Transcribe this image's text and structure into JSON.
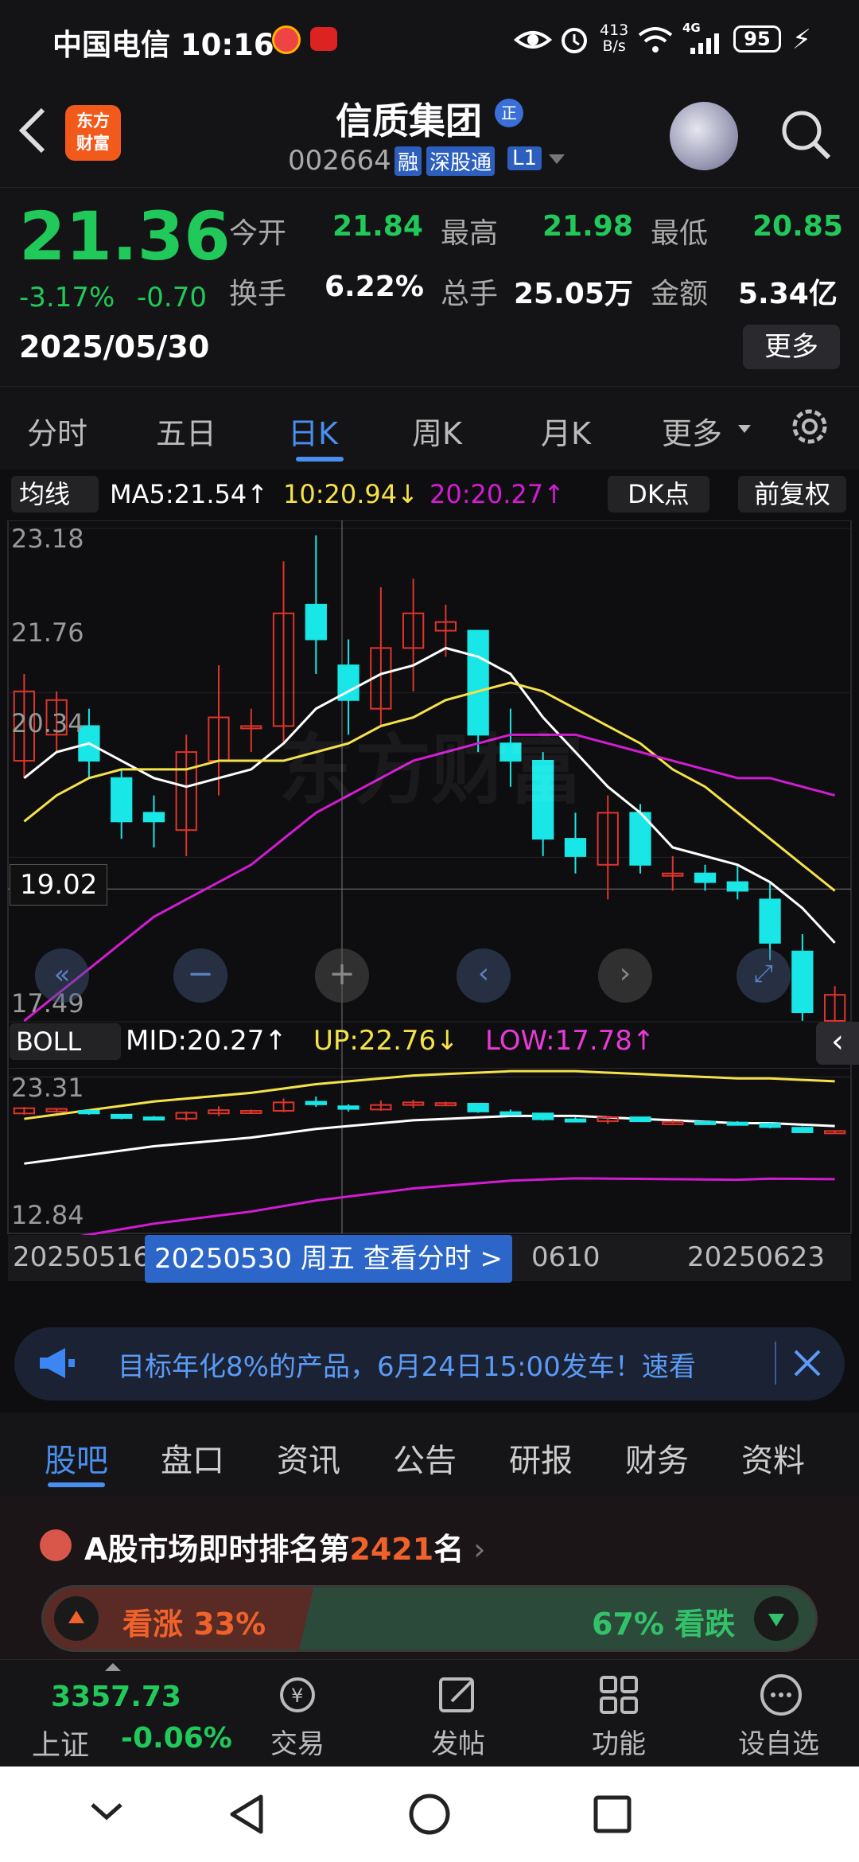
{
  "status_bar": {
    "carrier_time": "中国电信 10:16",
    "net_speed_value": "413",
    "net_speed_unit": "B/s",
    "signal_label": "4G",
    "battery": "95"
  },
  "header": {
    "app_logo_line1": "东方",
    "app_logo_line2": "财富",
    "stock_name": "信质集团",
    "stock_badge": "正",
    "stock_code": "002664",
    "tag_rong": "融",
    "tag_shengu": "深股通",
    "tag_level": "L1"
  },
  "quote": {
    "price": "21.36",
    "change_pct": "-3.17%",
    "change_abs": "-0.70",
    "date": "2025/05/30",
    "fields": [
      {
        "label": "今开",
        "value": "21.84"
      },
      {
        "label": "最高",
        "value": "21.98"
      },
      {
        "label": "最低",
        "value": "20.85"
      },
      {
        "label": "换手",
        "value": "6.22%"
      },
      {
        "label": "总手",
        "value": "25.05万"
      },
      {
        "label": "金额",
        "value": "5.34亿"
      }
    ],
    "more_label": "更多"
  },
  "period_tabs": [
    "分时",
    "五日",
    "日K",
    "周K",
    "月K",
    "更多"
  ],
  "indicator_row": {
    "ma_button": "均线",
    "ma5": "MA5:21.54↑",
    "ma10": "10:20.94↓",
    "ma20": "20:20.27↑",
    "dk_button": "DK点",
    "fq_button": "前复权"
  },
  "kline_axis": {
    "y_labels": [
      "23.18",
      "21.76",
      "20.34",
      "17.49"
    ],
    "crosshair_price": "19.02"
  },
  "boll_row": {
    "boll_button": "BOLL",
    "mid": "MID:20.27↑",
    "up": "UP:22.76↓",
    "low": "LOW:17.78↑"
  },
  "boll_axis": {
    "y_labels": [
      "23.31",
      "12.84"
    ]
  },
  "x_axis": {
    "left_date": "20250516",
    "mid_date_partial": "0610",
    "right_date": "20250623",
    "cursor_tip": "20250530 周五 查看分时 >"
  },
  "watermark": "东方财富",
  "notice": {
    "text": "目标年化8%的产品，6月24日15:00发车！速看"
  },
  "feature_tabs": [
    "股吧",
    "盘口",
    "资讯",
    "公告",
    "研报",
    "财务",
    "资料"
  ],
  "rank": {
    "prefix": "A股市场即时排名第",
    "number": "2421",
    "suffix": "名"
  },
  "sentiment": {
    "up_label": "看涨 33%",
    "down_label": "67% 看跌",
    "up_fraction": 0.33
  },
  "bottom_nav": {
    "index_value": "3357.73",
    "index_name": "上证",
    "index_change": "-0.06%",
    "items": [
      "交易",
      "发帖",
      "功能",
      "设自选"
    ]
  },
  "colors": {
    "up": "#e0342b",
    "down": "#19e6e6",
    "ma5": "#ffffff",
    "ma10": "#f5e24a",
    "ma20": "#d21cd2",
    "green": "#21c85a",
    "accent": "#4a8ff0"
  },
  "chart_data": {
    "type": "candlestick",
    "note_free": true,
    "ylim": [
      17.49,
      23.18
    ],
    "candles": [
      {
        "o": 20.5,
        "c": 21.3,
        "h": 21.5,
        "l": 20.3
      },
      {
        "o": 20.8,
        "c": 21.2,
        "h": 21.3,
        "l": 20.6
      },
      {
        "o": 20.9,
        "c": 20.5,
        "h": 21.1,
        "l": 20.3
      },
      {
        "o": 20.3,
        "c": 19.8,
        "h": 20.4,
        "l": 19.6
      },
      {
        "o": 19.9,
        "c": 19.8,
        "h": 20.1,
        "l": 19.5
      },
      {
        "o": 19.7,
        "c": 20.6,
        "h": 20.8,
        "l": 19.4
      },
      {
        "o": 20.5,
        "c": 21.0,
        "h": 21.6,
        "l": 20.1
      },
      {
        "o": 20.9,
        "c": 20.9,
        "h": 21.1,
        "l": 20.6
      },
      {
        "o": 20.9,
        "c": 22.2,
        "h": 22.8,
        "l": 20.7
      },
      {
        "o": 22.3,
        "c": 21.9,
        "h": 23.1,
        "l": 21.5
      },
      {
        "o": 21.6,
        "c": 21.2,
        "h": 21.9,
        "l": 20.8
      },
      {
        "o": 21.1,
        "c": 21.8,
        "h": 22.5,
        "l": 20.9
      },
      {
        "o": 21.8,
        "c": 22.2,
        "h": 22.6,
        "l": 21.3
      },
      {
        "o": 22.0,
        "c": 22.1,
        "h": 22.3,
        "l": 21.7
      },
      {
        "o": 22.0,
        "c": 20.8,
        "h": 22.0,
        "l": 20.6
      },
      {
        "o": 20.7,
        "c": 20.5,
        "h": 21.1,
        "l": 20.2
      },
      {
        "o": 20.5,
        "c": 19.6,
        "h": 20.6,
        "l": 19.4
      },
      {
        "o": 19.6,
        "c": 19.4,
        "h": 19.9,
        "l": 19.2
      },
      {
        "o": 19.3,
        "c": 19.9,
        "h": 20.1,
        "l": 18.9
      },
      {
        "o": 19.9,
        "c": 19.3,
        "h": 20.0,
        "l": 19.2
      },
      {
        "o": 19.2,
        "c": 19.2,
        "h": 19.4,
        "l": 19.0
      },
      {
        "o": 19.2,
        "c": 19.1,
        "h": 19.3,
        "l": 19.0
      },
      {
        "o": 19.1,
        "c": 19.0,
        "h": 19.3,
        "l": 18.9
      },
      {
        "o": 18.9,
        "c": 18.4,
        "h": 19.1,
        "l": 18.2
      },
      {
        "o": 18.3,
        "c": 17.6,
        "h": 18.5,
        "l": 17.5
      },
      {
        "o": 17.5,
        "c": 17.8,
        "h": 17.9,
        "l": 17.4
      }
    ],
    "ma5": [
      20.3,
      20.6,
      20.7,
      20.5,
      20.3,
      20.2,
      20.3,
      20.4,
      20.7,
      21.1,
      21.3,
      21.5,
      21.6,
      21.8,
      21.7,
      21.5,
      21.0,
      20.6,
      20.2,
      19.9,
      19.5,
      19.4,
      19.3,
      19.1,
      18.8,
      18.4
    ],
    "ma10": [
      19.8,
      20.1,
      20.3,
      20.4,
      20.4,
      20.4,
      20.5,
      20.5,
      20.5,
      20.6,
      20.7,
      20.9,
      21.0,
      21.2,
      21.3,
      21.4,
      21.3,
      21.1,
      20.9,
      20.7,
      20.4,
      20.2,
      19.9,
      19.6,
      19.3,
      19.0
    ],
    "ma20": [
      17.5,
      17.8,
      18.1,
      18.4,
      18.7,
      18.9,
      19.1,
      19.3,
      19.6,
      19.9,
      20.1,
      20.3,
      20.5,
      20.6,
      20.7,
      20.8,
      20.8,
      20.8,
      20.7,
      20.6,
      20.5,
      20.4,
      20.3,
      20.3,
      20.2,
      20.1
    ]
  }
}
